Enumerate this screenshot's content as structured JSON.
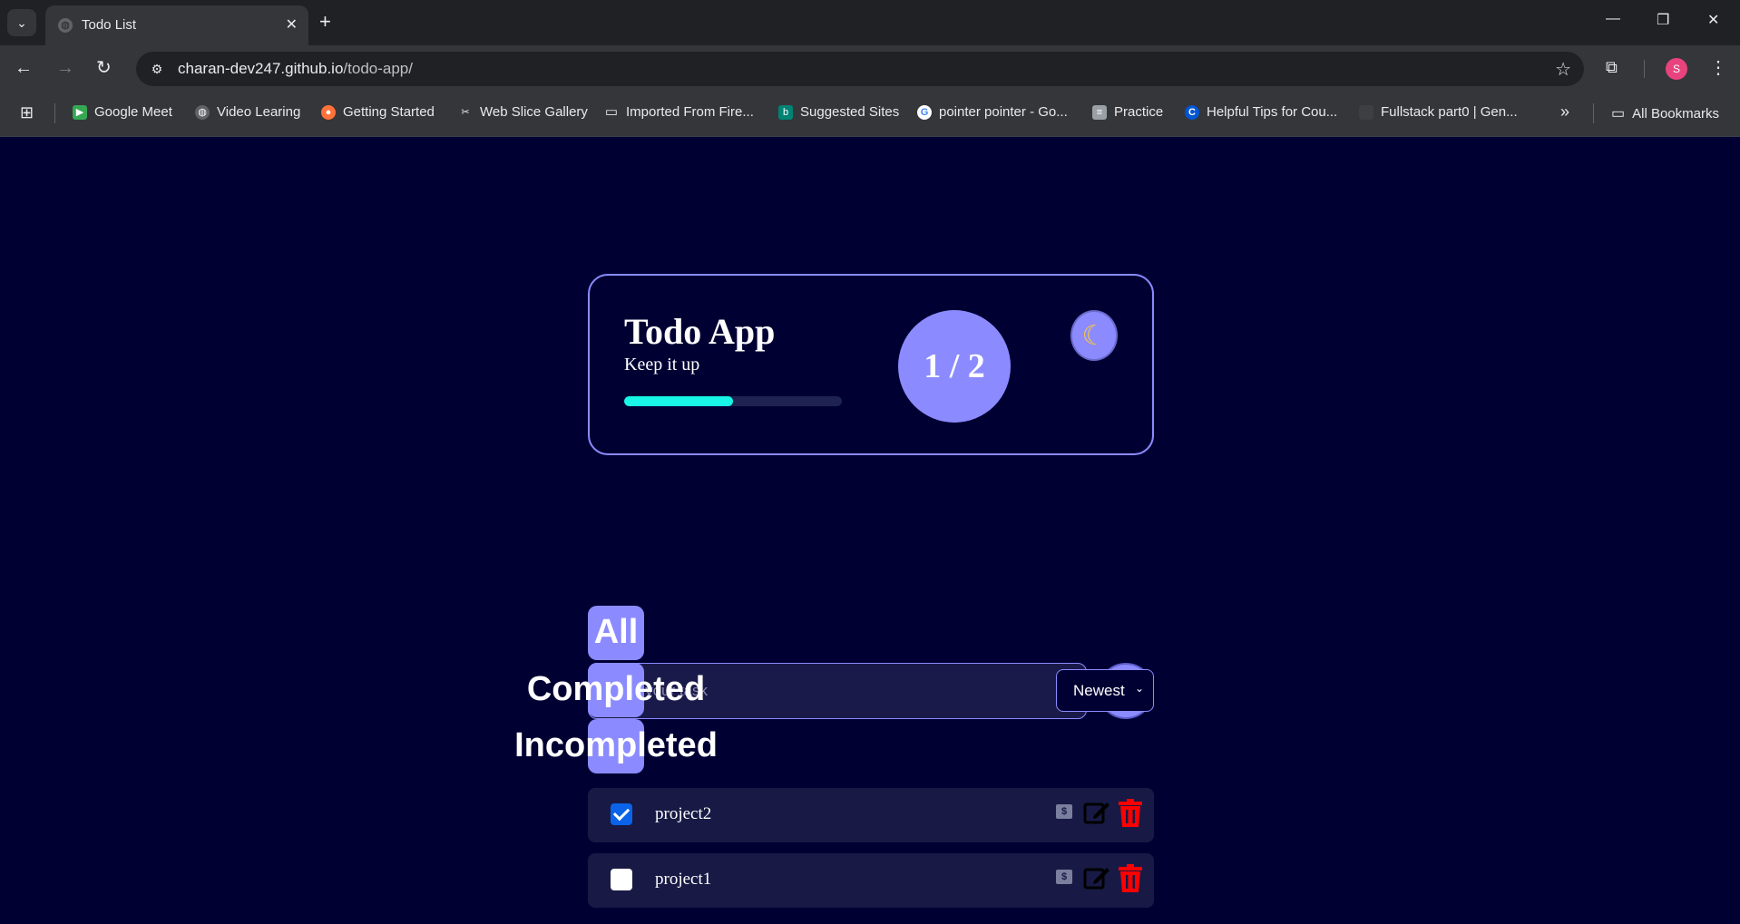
{
  "browser": {
    "tab_title": "Todo List",
    "url_host": "charan-dev247.github.io",
    "url_path": "/todo-app/",
    "profile_initial": "S",
    "bookmarks": [
      {
        "label": "Google Meet",
        "icon": "google-meet-icon",
        "color": "#34a853"
      },
      {
        "label": "Video Learing",
        "icon": "globe-icon",
        "color": "#5f6368"
      },
      {
        "label": "Getting Started",
        "icon": "firefox-icon",
        "color": "#ff7139"
      },
      {
        "label": "Web Slice Gallery",
        "icon": "web-slice-icon",
        "color": "#e8eaed"
      },
      {
        "label": "Imported From Fire...",
        "icon": "folder-icon",
        "color": "#e8eaed"
      },
      {
        "label": "Suggested Sites",
        "icon": "bing-icon",
        "color": "#008373"
      },
      {
        "label": "pointer pointer - Go...",
        "icon": "google-icon",
        "color": "#4285f4"
      },
      {
        "label": "Practice",
        "icon": "notepad-icon",
        "color": "#9aa0a6"
      },
      {
        "label": "Helpful Tips for Cou...",
        "icon": "coursera-icon",
        "color": "#0056d2"
      },
      {
        "label": "Fullstack part0 | Gen...",
        "icon": "page-icon",
        "color": "#3c4043"
      }
    ],
    "all_bookmarks": "All Bookmarks"
  },
  "hero": {
    "title": "Todo App",
    "subtitle": "Keep it up",
    "progress": 0.5,
    "counter": "1 / 2",
    "theme_icon": "moon-icon"
  },
  "input": {
    "placeholder": "Write your task",
    "value": "",
    "add_label": "+"
  },
  "filters": [
    "All",
    "Completed",
    "Incompleted"
  ],
  "sort": {
    "selected": "Newest"
  },
  "todos": [
    {
      "text": "project2",
      "done": true
    },
    {
      "text": "project1",
      "done": false
    }
  ],
  "colors": {
    "background": "#000033",
    "accent": "#8b8bff",
    "progress": "#19f5e6",
    "delete": "#ff0000"
  }
}
